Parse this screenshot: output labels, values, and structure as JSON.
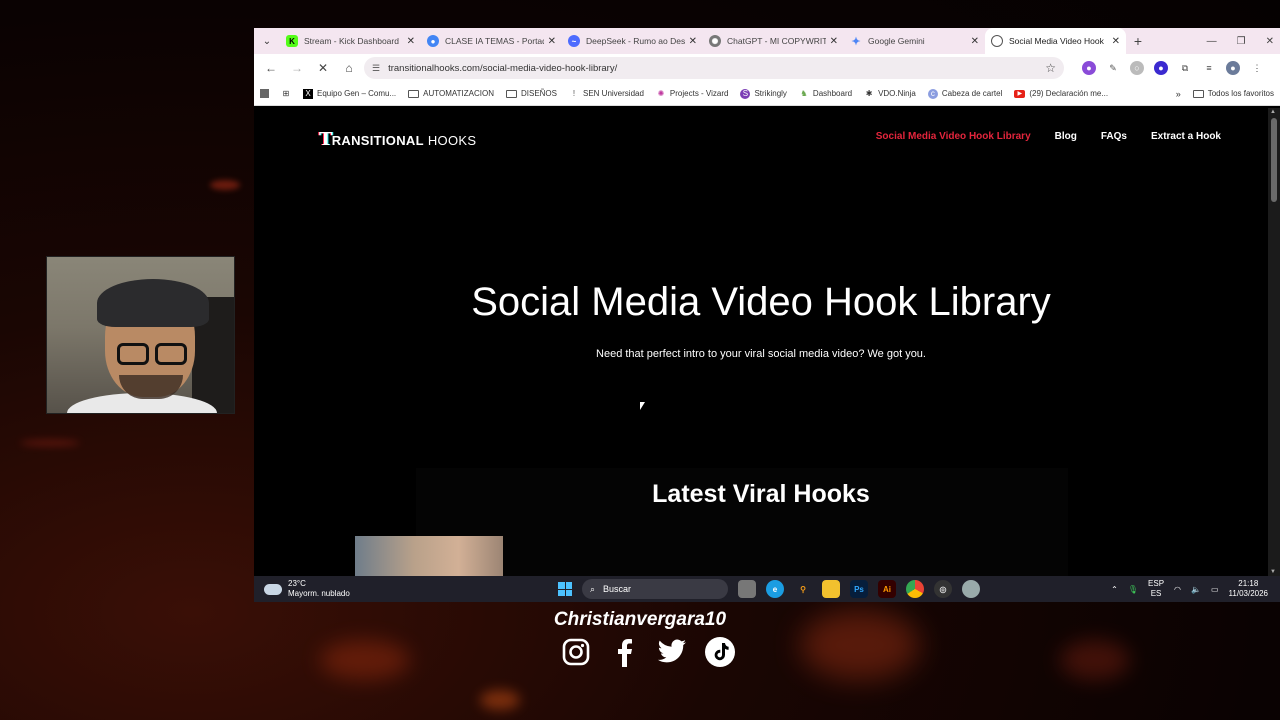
{
  "browser": {
    "tabs": [
      {
        "title": "Stream - Kick Dashboard",
        "favicon": "kick-icon",
        "active": false
      },
      {
        "title": "CLASE IA TEMAS - Portada",
        "favicon": "chrome-doc-icon",
        "active": false
      },
      {
        "title": "DeepSeek - Rumo ao Des",
        "favicon": "deepseek-icon",
        "active": false
      },
      {
        "title": "ChatGPT - MI COPYWRITE",
        "favicon": "chatgpt-icon",
        "active": false
      },
      {
        "title": "Google Gemini",
        "favicon": "gemini-icon",
        "active": false
      },
      {
        "title": "Social Media Video Hook",
        "favicon": "site-icon",
        "active": true
      }
    ],
    "url": "transitionalhooks.com/social-media-video-hook-library/",
    "bookmarks": [
      {
        "label": "Equipo Gen – Comu...",
        "icon": "x-icon"
      },
      {
        "label": "AUTOMATIZACION",
        "icon": "folder-icon"
      },
      {
        "label": "DISEÑOS",
        "icon": "folder-icon"
      },
      {
        "label": "SEN Universidad",
        "icon": "pin-icon"
      },
      {
        "label": "Projects - Vizard",
        "icon": "vizard-icon"
      },
      {
        "label": "Strikingly",
        "icon": "strikingly-icon"
      },
      {
        "label": "Dashboard",
        "icon": "dashboard-icon"
      },
      {
        "label": "VDO.Ninja",
        "icon": "ninja-icon"
      },
      {
        "label": "Cabeza de cartel",
        "icon": "cartel-icon"
      },
      {
        "label": "(29) Declaración me...",
        "icon": "youtube-icon"
      }
    ],
    "all_bookmarks_label": "Todos los favoritos"
  },
  "site": {
    "logo_mark": "T",
    "logo_bold": "RANSITIONAL",
    "logo_thin": "HOOKS",
    "nav": [
      {
        "label": "Social Media Video Hook Library",
        "active": true
      },
      {
        "label": "Blog",
        "active": false
      },
      {
        "label": "FAQs",
        "active": false
      },
      {
        "label": "Extract a Hook",
        "active": false
      }
    ],
    "hero_title": "Social Media Video Hook Library",
    "hero_subtitle": "Need that perfect intro to your viral social media video? We got you.",
    "section_title": "Latest Viral Hooks"
  },
  "taskbar": {
    "temperature": "23°C",
    "weather": "Mayorm. nublado",
    "search_placeholder": "Buscar",
    "lang_top": "ESP",
    "lang_bottom": "ES",
    "time": "21:18",
    "date": "11/03/2026"
  },
  "overlay": {
    "handle": "Christianvergara10",
    "socials": [
      "instagram-icon",
      "facebook-icon",
      "twitter-icon",
      "tiktok-icon"
    ]
  },
  "colors": {
    "nav_active": "#e3253c",
    "tab_strip": "#f4e6f0",
    "taskbar": "#20202a"
  }
}
